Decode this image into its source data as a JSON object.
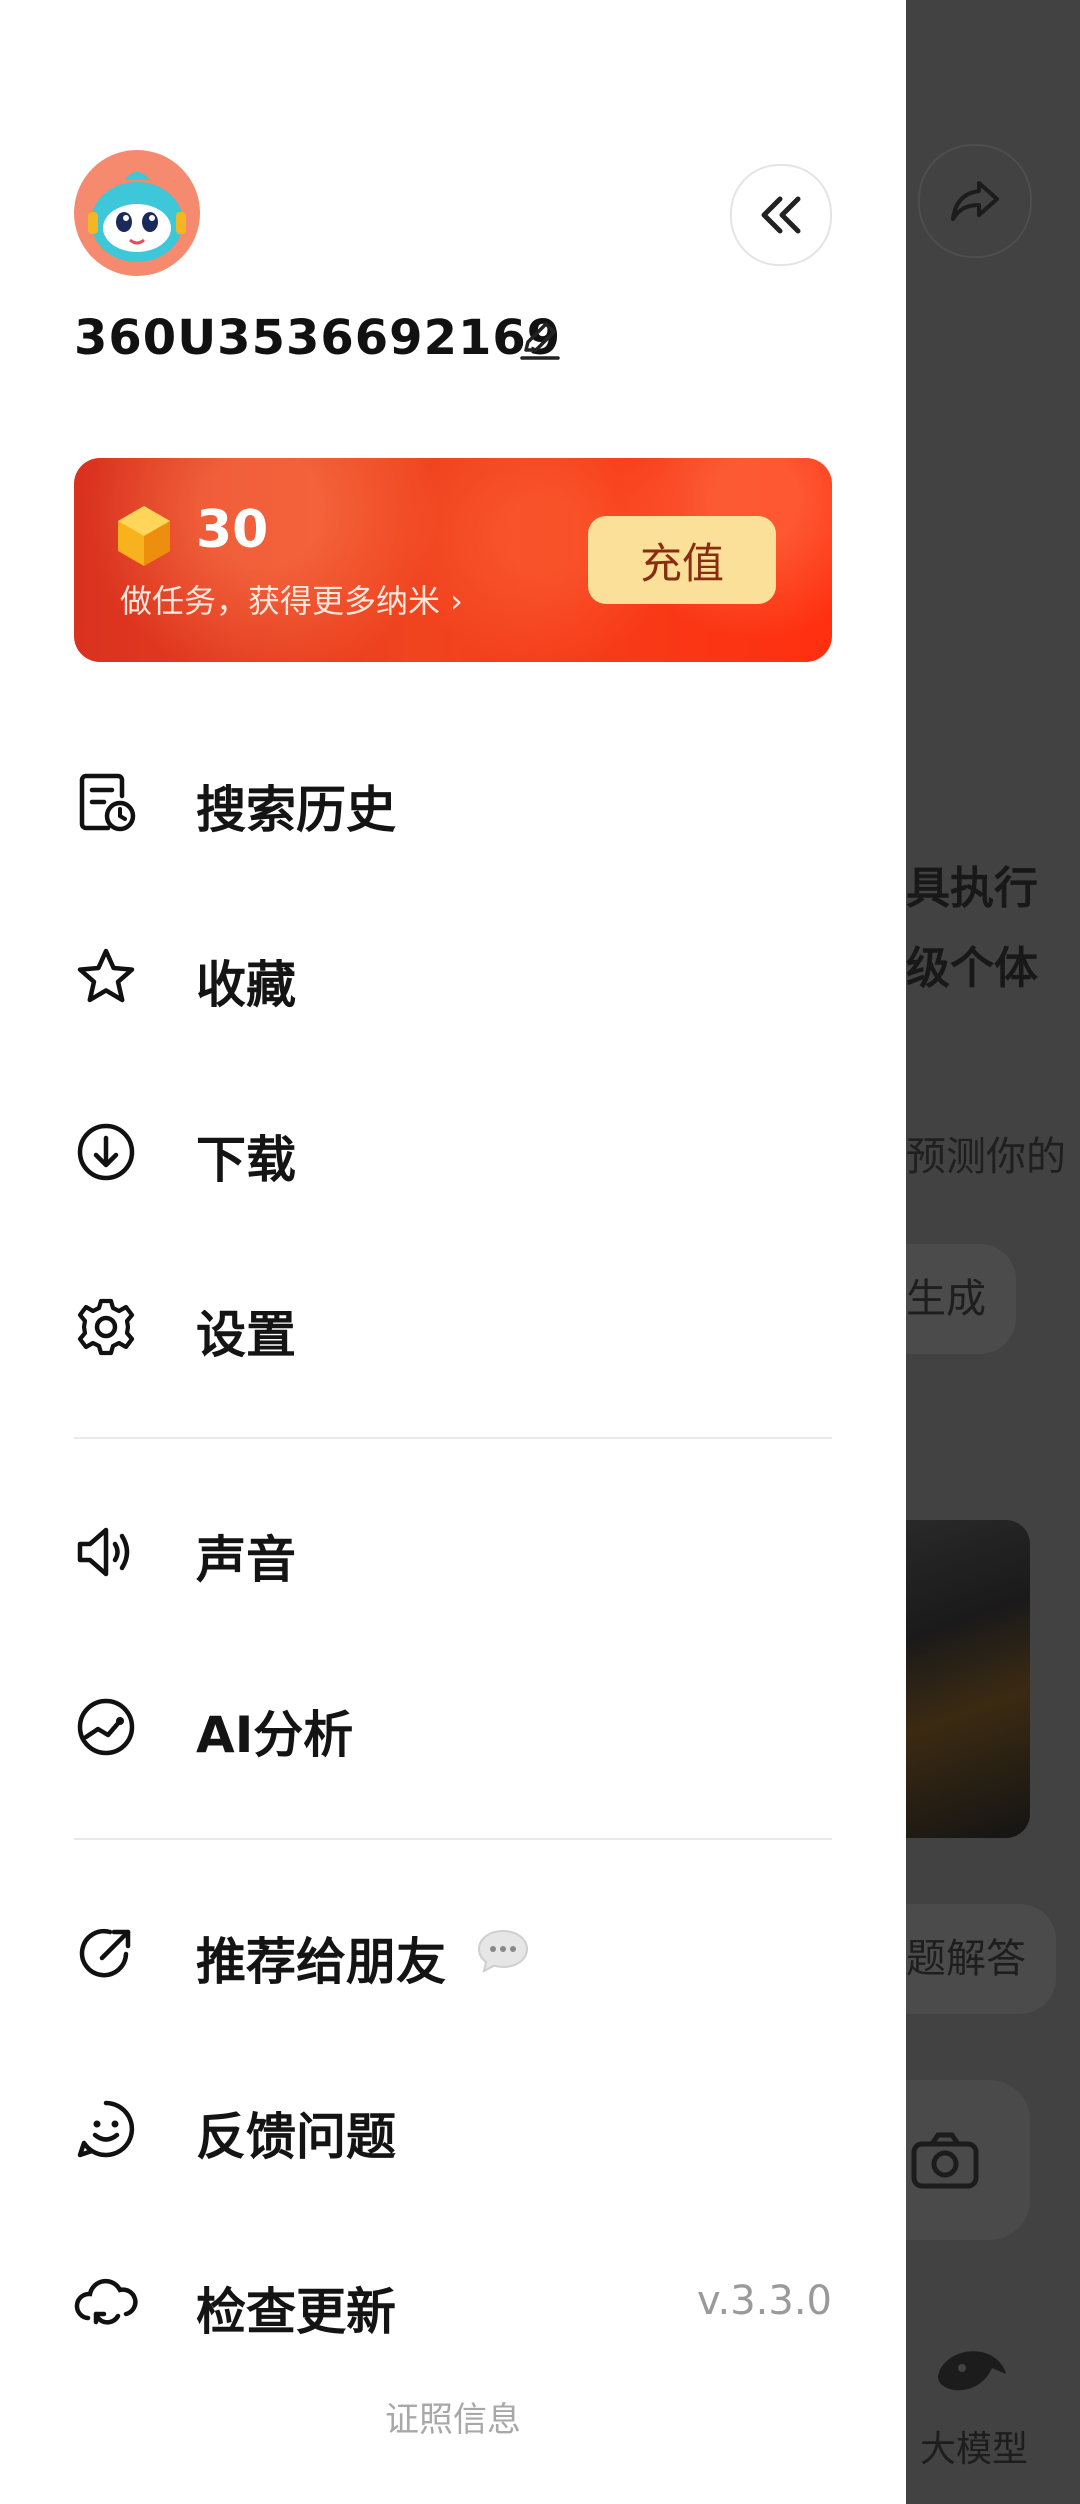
{
  "background": {
    "line1": "具执行",
    "line2": "级个体",
    "line3": "预测你的",
    "chip1": "生成",
    "chip2": "题解答",
    "nav_label": "大模型"
  },
  "profile": {
    "username": "360U3536692169"
  },
  "coin_banner": {
    "count": "30",
    "tip": "做任务，获得更多纳米 ›",
    "recharge_label": "充值"
  },
  "menu": {
    "search_history": "搜索历史",
    "favorites": "收藏",
    "downloads": "下载",
    "settings": "设置",
    "sound": "声音",
    "ai_analysis": "AI分析",
    "recommend": "推荐给朋友",
    "feedback": "反馈问题",
    "check_update": "检查更新",
    "version": "v.3.3.0"
  },
  "footer": {
    "license": "证照信息"
  },
  "colors": {
    "banner_red": "#f0441f",
    "recharge_bg": "#fbe09a",
    "avatar_bg": "#f58a6f"
  }
}
